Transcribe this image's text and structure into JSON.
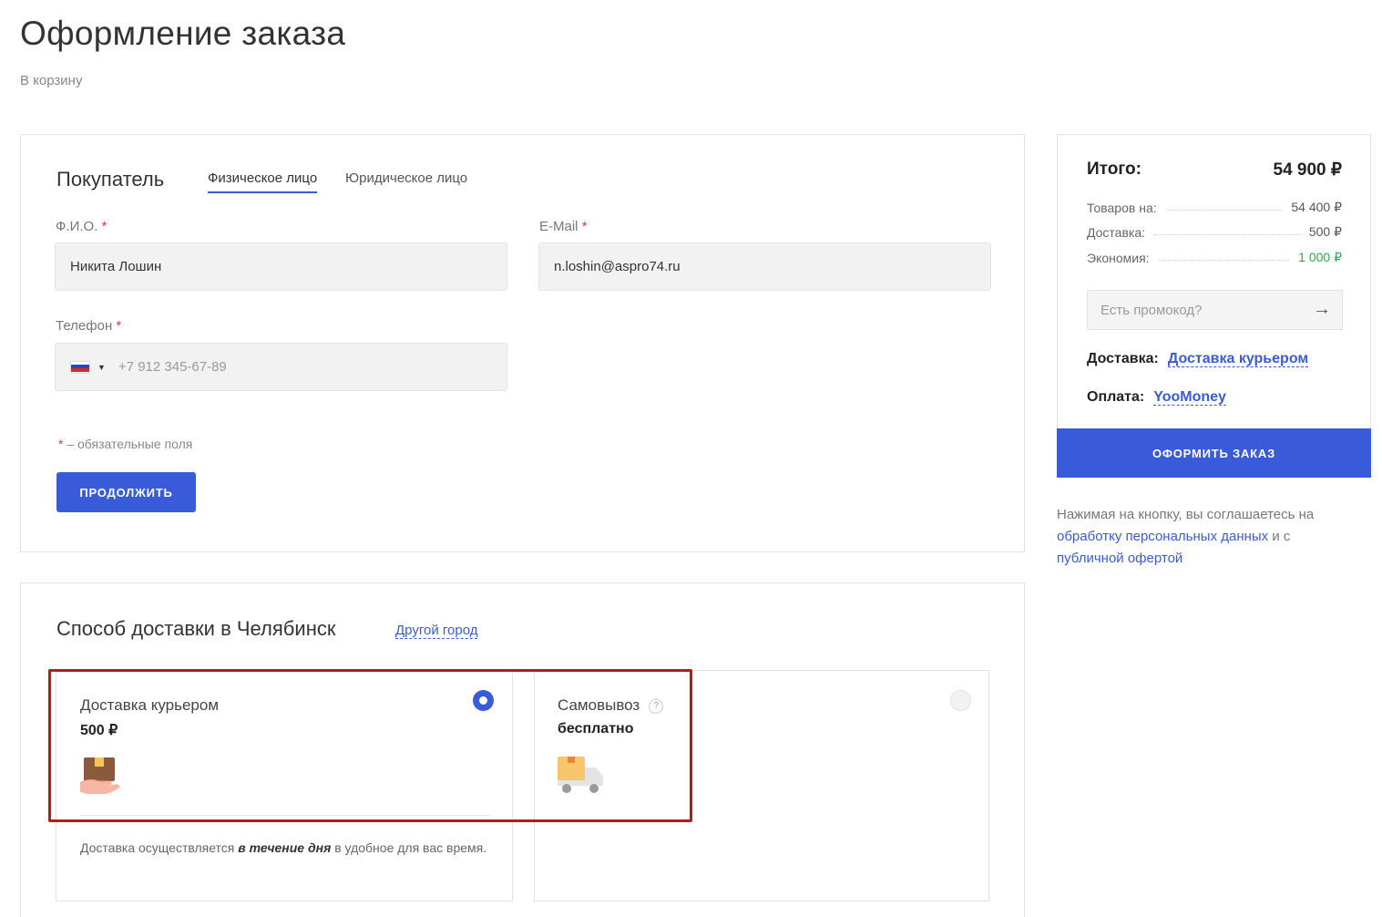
{
  "header": {
    "title": "Оформление заказа",
    "back_link": "В корзину"
  },
  "buyer": {
    "title": "Покупатель",
    "tabs": [
      {
        "label": "Физическое лицо",
        "active": true
      },
      {
        "label": "Юридическое лицо",
        "active": false
      }
    ],
    "fields": {
      "fio": {
        "label": "Ф.И.О.",
        "value": "Никита Лошин"
      },
      "email": {
        "label": "E-Mail",
        "value": "n.loshin@aspro74.ru"
      },
      "phone": {
        "label": "Телефон",
        "placeholder": "+7 912 345-67-89",
        "country": "RU"
      }
    },
    "required_mark": "*",
    "required_note": "– обязательные поля",
    "continue_label": "ПРОДОЛЖИТЬ"
  },
  "delivery": {
    "title": "Способ доставки в Челябинск",
    "other_city": "Другой город",
    "options": [
      {
        "title": "Доставка курьером",
        "price": "500 ₽",
        "selected": true,
        "icon": "box-in-hand-icon",
        "desc_before": "Доставка осуществляется ",
        "desc_bold": "в течение дня",
        "desc_after": " в удобное для вас время."
      },
      {
        "title": "Самовывоз",
        "price": "бесплатно",
        "selected": false,
        "icon": "delivery-truck-icon",
        "help": "?"
      }
    ]
  },
  "summary": {
    "total_label": "Итого:",
    "total_value": "54 900 ₽",
    "rows": [
      {
        "label": "Товаров на:",
        "value": "54 400 ₽"
      },
      {
        "label": "Доставка:",
        "value": "500 ₽"
      },
      {
        "label": "Экономия:",
        "value": "1 000 ₽",
        "color": "#2fa84f"
      }
    ],
    "promo_placeholder": "Есть промокод?",
    "delivery_label": "Доставка:",
    "delivery_value": "Доставка курьером",
    "payment_label": "Оплата:",
    "payment_value": "YooMoney",
    "submit_label": "ОФОРМИТЬ ЗАКАЗ",
    "agreement_text": "Нажимая на кнопку, вы соглашаетесь на",
    "agreement_link1": "обработку персональных данных",
    "agreement_and": "и с",
    "agreement_link2": "публичной офертой"
  },
  "colors": {
    "accent": "#3a5bd9",
    "required": "#e0383e",
    "savings": "#2fa84f",
    "highlight": "#b21c1c"
  }
}
